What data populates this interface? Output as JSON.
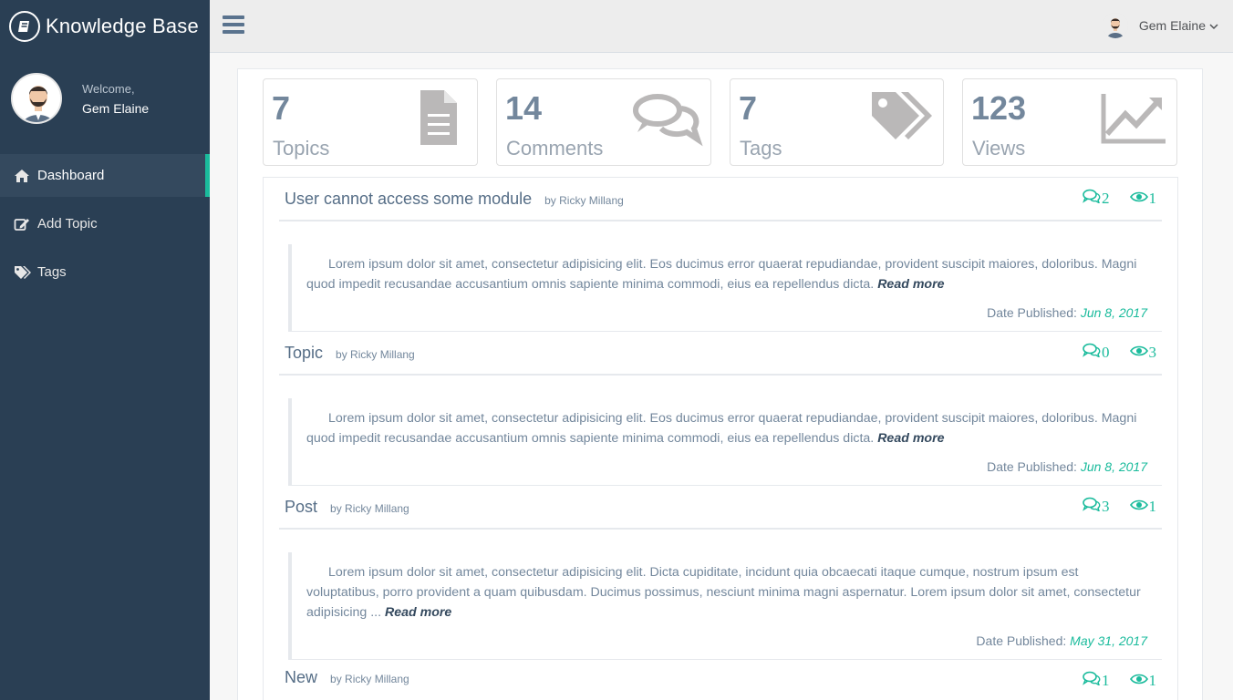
{
  "brand": {
    "title": "Knowledge Base"
  },
  "profile": {
    "welcome": "Welcome,",
    "name": "Gem Elaine"
  },
  "nav": [
    {
      "label": "Dashboard",
      "icon": "home-icon"
    },
    {
      "label": "Add Topic",
      "icon": "edit-icon"
    },
    {
      "label": "Tags",
      "icon": "tags-icon"
    }
  ],
  "topbar": {
    "user_name": "Gem Elaine",
    "caret": "⌵"
  },
  "stats": [
    {
      "count": "7",
      "label": "Topics",
      "icon": "file-icon"
    },
    {
      "count": "14",
      "label": "Comments",
      "icon": "comments-icon"
    },
    {
      "count": "7",
      "label": "Tags",
      "icon": "tags-icon"
    },
    {
      "count": "123",
      "label": "Views",
      "icon": "chart-line-icon"
    }
  ],
  "topics": [
    {
      "title": "User cannot access some module",
      "author": "by Ricky Millang",
      "comments": "2",
      "views": "1",
      "excerpt": "Lorem ipsum dolor sit amet, consectetur adipisicing elit. Eos ducimus error quaerat repudiandae, provident suscipit maiores, doloribus. Magni quod impedit recusandae accusantium omnis sapiente minima commodi, eius ea repellendus dicta.",
      "read_more": "Read more",
      "published_label": "Date Published:",
      "published_date": "Jun 8, 2017"
    },
    {
      "title": "Topic",
      "author": "by Ricky Millang",
      "comments": "0",
      "views": "3",
      "excerpt": "Lorem ipsum dolor sit amet, consectetur adipisicing elit. Eos ducimus error quaerat repudiandae, provident suscipit maiores, doloribus. Magni quod impedit recusandae accusantium omnis sapiente minima commodi, eius ea repellendus dicta.",
      "read_more": "Read more",
      "published_label": "Date Published:",
      "published_date": "Jun 8, 2017"
    },
    {
      "title": "Post",
      "author": "by Ricky Millang",
      "comments": "3",
      "views": "1",
      "excerpt": "Lorem ipsum dolor sit amet, consectetur adipisicing elit. Dicta cupiditate, incidunt quia obcaecati itaque cumque, nostrum ipsum est voluptatibus, porro provident a quam quibusdam. Ducimus possimus, nesciunt minima magni aspernatur. Lorem ipsum dolor sit amet, consectetur adipisicing ...",
      "read_more": "Read more",
      "published_label": "Date Published:",
      "published_date": "May 31, 2017"
    },
    {
      "title": "New",
      "author": "by Ricky Millang",
      "comments": "1",
      "views": "1"
    }
  ],
  "colors": {
    "sidebar": "#2a3f54",
    "accent": "#1abb9c",
    "text": "#73879c"
  }
}
